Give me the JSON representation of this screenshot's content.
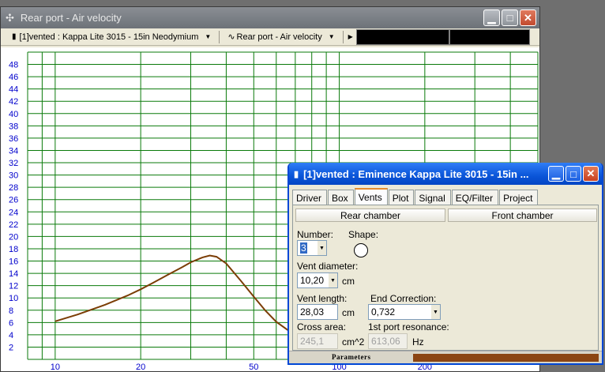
{
  "main_window": {
    "title": "Rear port - Air velocity",
    "toolbar": {
      "project_label": "[1]vented : Kappa Lite 3015 - 15in Neodymium",
      "graph_label": "Rear port - Air velocity"
    }
  },
  "chart_data": {
    "type": "line",
    "x_scale": "log",
    "xlim": [
      8,
      500
    ],
    "ylim": [
      0,
      50
    ],
    "x_ticks": [
      "10",
      "20",
      "50",
      "100",
      "200"
    ],
    "y_ticks": [
      "2",
      "4",
      "6",
      "8",
      "10",
      "12",
      "14",
      "16",
      "18",
      "20",
      "22",
      "24",
      "26",
      "28",
      "30",
      "32",
      "34",
      "36",
      "38",
      "40",
      "42",
      "44",
      "46",
      "48"
    ],
    "grid": true,
    "colors": {
      "grid": "#0a7a0a",
      "curve": "#7b3d05",
      "ticks": "#0000cc"
    },
    "series": [
      {
        "x": [
          10,
          12,
          15,
          18,
          20,
          22,
          25,
          28,
          30,
          33,
          35,
          37,
          40,
          45,
          50,
          55,
          60,
          70,
          80,
          90,
          100,
          120,
          140,
          170,
          200,
          250,
          300,
          350
        ],
        "y": [
          6.2,
          7.3,
          8.9,
          10.4,
          11.4,
          12.4,
          13.8,
          15.0,
          15.8,
          16.6,
          16.9,
          16.7,
          15.6,
          12.8,
          10.2,
          7.9,
          6.1,
          3.9,
          2.7,
          2.0,
          1.5,
          0.95,
          0.65,
          0.4,
          0.25,
          0.12,
          0.06,
          0.03
        ]
      }
    ]
  },
  "dialog": {
    "title": "[1]vented : Eminence Kappa Lite 3015 - 15in ...",
    "tabs": [
      "Driver",
      "Box",
      "Vents",
      "Plot",
      "Signal",
      "EQ/Filter",
      "Project"
    ],
    "active_tab": "Vents",
    "rear_chamber_label": "Rear chamber",
    "front_chamber_label": "Front chamber",
    "number_label": "Number:",
    "number_value": "3",
    "shape_label": "Shape:",
    "vent_diameter_label": "Vent diameter:",
    "vent_diameter_value": "10,20",
    "vent_diameter_unit": "cm",
    "vent_length_label": "Vent length:",
    "vent_length_value": "28,03",
    "vent_length_unit": "cm",
    "end_correction_label": "End Correction:",
    "end_correction_value": "0,732",
    "cross_area_label": "Cross area:",
    "cross_area_value": "245,1",
    "cross_area_unit": "cm^2",
    "port_resonance_label": "1st port resonance:",
    "port_resonance_value": "613,06",
    "port_resonance_unit": "Hz",
    "status_text": "Parameters"
  }
}
